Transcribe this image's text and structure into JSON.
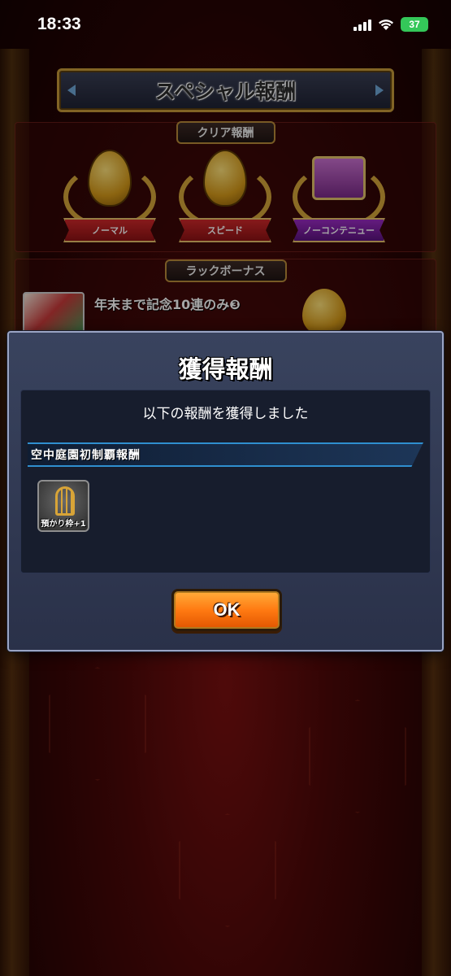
{
  "status_bar": {
    "time": "18:33",
    "battery": "37"
  },
  "screen": {
    "title": "スペシャル報酬",
    "clear_rewards_label": "クリア報酬",
    "medals": [
      {
        "label": "ノーマル"
      },
      {
        "label": "スピード"
      },
      {
        "label": "ノーコンテニュー"
      }
    ],
    "luck_bonus_label": "ラックボーナス",
    "luck_item_label": "年末まで記念10連のみ❸"
  },
  "dialog": {
    "heading": "獲得報酬",
    "message": "以下の報酬を獲得しました",
    "section_title": "空中庭園初制覇報酬",
    "item_caption": "預かり枠+1",
    "ok_label": "OK"
  },
  "colors": {
    "ok_button": "#ff7a12",
    "dialog_bg": "#39435e",
    "subheader_accent": "#2f8fcf",
    "battery": "#34c759"
  }
}
